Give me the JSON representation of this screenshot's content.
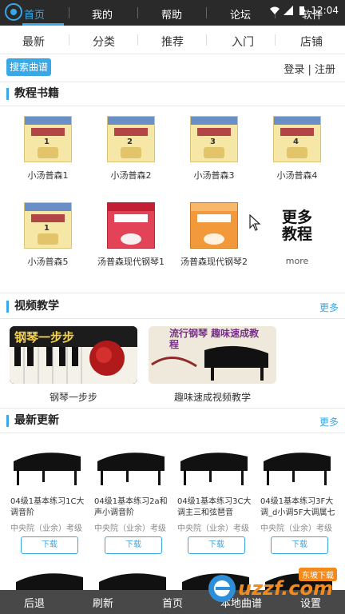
{
  "status": {
    "time": "12:04"
  },
  "top_nav": [
    {
      "label": "首页",
      "active": true
    },
    {
      "label": "我的",
      "active": false
    },
    {
      "label": "帮助",
      "active": false
    },
    {
      "label": "论坛",
      "active": false
    },
    {
      "label": "软件",
      "active": false
    }
  ],
  "sub_tabs": [
    "最新",
    "分类",
    "推荐",
    "入门",
    "店铺"
  ],
  "search_button": "搜索曲谱",
  "login_text": "登录 | 注册",
  "books_section": {
    "title": "教程书籍",
    "items": [
      {
        "label": "小汤普森1",
        "num": "1"
      },
      {
        "label": "小汤普森2",
        "num": "2"
      },
      {
        "label": "小汤普森3",
        "num": "3"
      },
      {
        "label": "小汤普森4",
        "num": "4"
      },
      {
        "label": "小汤普森5",
        "num": "1"
      },
      {
        "label": "汤普森现代钢琴1",
        "num": ""
      },
      {
        "label": "汤普森现代钢琴2",
        "num": ""
      }
    ],
    "more_tile_line1": "更多",
    "more_tile_line2": "教程",
    "more_label": "more"
  },
  "video_section": {
    "title": "视频教学",
    "more": "更多",
    "items": [
      {
        "label": "钢琴一步步",
        "banner": "钢琴一步步"
      },
      {
        "label": "趣味速成视频教学",
        "banner": "流行钢琴 趣味速成教程"
      }
    ]
  },
  "latest_section": {
    "title": "最新更新",
    "more": "更多",
    "items": [
      {
        "title": "04级1基本练习1C大调音阶",
        "sub": "中央院（业余）考级",
        "button": "下载"
      },
      {
        "title": "04级1基本练习2a和声小调音阶",
        "sub": "中央院（业余）考级",
        "button": "下载"
      },
      {
        "title": "04级1基本练习3C大调主三和弦琶音",
        "sub": "中央院（业余）考级",
        "button": "下载"
      },
      {
        "title": "04级1基本练习3F大调_d小调5F大调属七",
        "sub": "中央院（业余）考级",
        "button": "下载"
      }
    ]
  },
  "bottom_bar": [
    "后退",
    "刷新",
    "首页",
    "本地曲谱",
    "设置"
  ],
  "watermark": {
    "text": "uzzf.com",
    "badge": "东坡下载"
  },
  "colors": {
    "accent": "#3aa7e6",
    "topbar": "#2a2a2a",
    "icon": "status-icons"
  }
}
